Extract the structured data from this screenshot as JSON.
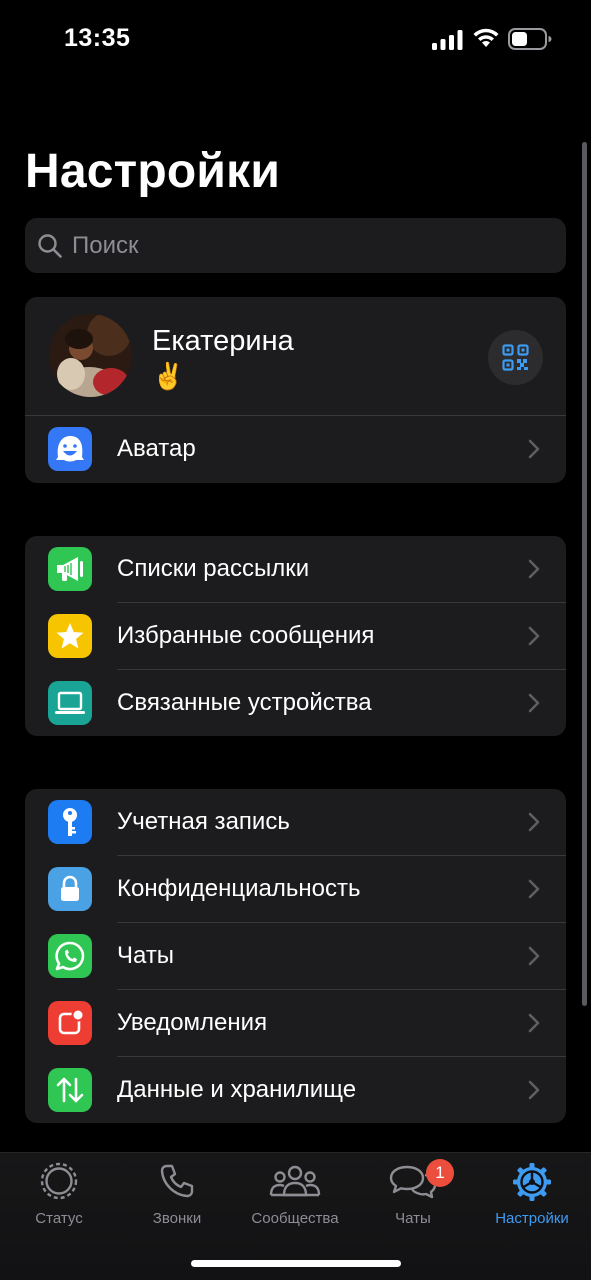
{
  "status_bar": {
    "time": "13:35"
  },
  "page": {
    "title": "Настройки"
  },
  "search": {
    "placeholder": "Поиск"
  },
  "profile": {
    "name": "Екатерина",
    "status": "✌️"
  },
  "profile_group": {
    "items": [
      {
        "label": "Аватар",
        "icon": "avatar-face-icon",
        "color": "#3478f6"
      }
    ]
  },
  "group_tools": {
    "items": [
      {
        "label": "Списки рассылки",
        "icon": "megaphone-icon",
        "color": "#30c653"
      },
      {
        "label": "Избранные сообщения",
        "icon": "star-icon",
        "color": "#f7c500"
      },
      {
        "label": "Связанные устройства",
        "icon": "laptop-icon",
        "color": "#19a496"
      }
    ]
  },
  "group_settings": {
    "items": [
      {
        "label": "Учетная запись",
        "icon": "key-icon",
        "color": "#1d7cf2"
      },
      {
        "label": "Конфиденциальность",
        "icon": "lock-icon",
        "color": "#4aa1e4"
      },
      {
        "label": "Чаты",
        "icon": "whatsapp-icon",
        "color": "#30c653"
      },
      {
        "label": "Уведомления",
        "icon": "notification-icon",
        "color": "#ee3d33"
      },
      {
        "label": "Данные и хранилище",
        "icon": "arrows-up-down-icon",
        "color": "#30c653"
      }
    ]
  },
  "tabbar": {
    "tabs": [
      {
        "label": "Статус",
        "icon": "status-icon",
        "active": false
      },
      {
        "label": "Звонки",
        "icon": "phone-icon",
        "active": false
      },
      {
        "label": "Сообщества",
        "icon": "communities-icon",
        "active": false
      },
      {
        "label": "Чаты",
        "icon": "chats-icon",
        "active": false,
        "badge": "1"
      },
      {
        "label": "Настройки",
        "icon": "settings-gear-icon",
        "active": true
      }
    ]
  },
  "colors": {
    "accent": "#3e9bf2",
    "badge": "#eb4e3d",
    "group_bg": "#1c1c1e"
  }
}
